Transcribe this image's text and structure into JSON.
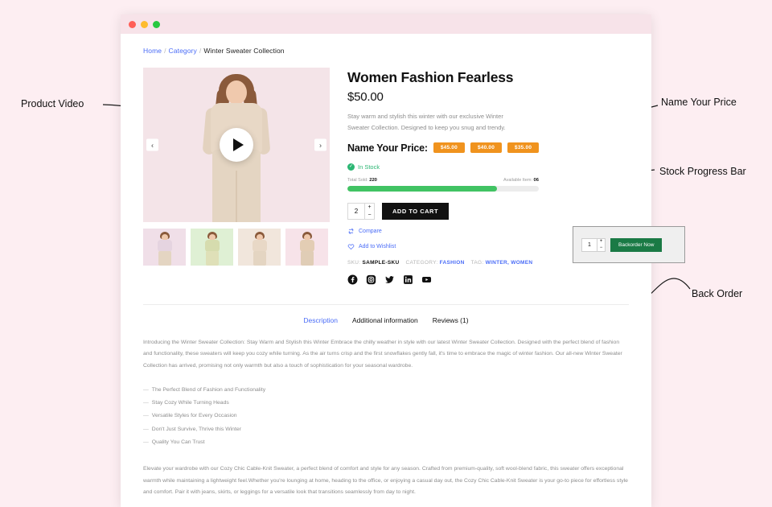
{
  "window": {
    "dots": [
      "close",
      "minimize",
      "maximize"
    ]
  },
  "breadcrumb": {
    "home": "Home",
    "category": "Category",
    "current": "Winter Sweater Collection",
    "separator": "/"
  },
  "gallery": {
    "prev_icon": "chevron-left-icon",
    "next_icon": "chevron-right-icon",
    "play_icon": "play-icon",
    "thumbnails": [
      {
        "bg": "#f0dfe8"
      },
      {
        "bg": "#dff0d4"
      },
      {
        "bg": "#f1e6dc"
      },
      {
        "bg": "#f7e3e9"
      }
    ]
  },
  "product": {
    "title": "Women Fashion Fearless",
    "price": "$50.00",
    "description": "Stay warm and stylish this winter with our exclusive Winter Sweater Collection. Designed to keep you snug and trendy.",
    "name_your_price_label": "Name Your Price:",
    "price_options": [
      "$45.00",
      "$40.00",
      "$35.00"
    ],
    "stock_status": "In Stock",
    "total_sold_label": "Total Sold:",
    "total_sold_value": "220",
    "available_label": "Available Item:",
    "available_value": "06",
    "progress_percent": 78,
    "quantity": "2",
    "add_to_cart_label": "ADD TO CART",
    "compare_label": "Compare",
    "wishlist_label": "Add to Wishlist",
    "meta": {
      "sku_label": "SKU:",
      "sku_value": "SAMPLE-SKU",
      "category_label": "CATEGORY:",
      "category_value": "FASHION",
      "tag_label": "TAG:",
      "tag_value": "WINTER, WOMEN"
    },
    "socials": [
      "facebook-icon",
      "instagram-icon",
      "twitter-icon",
      "linkedin-icon",
      "youtube-icon"
    ]
  },
  "tabs": [
    {
      "label": "Description",
      "active": true
    },
    {
      "label": "Additional information",
      "active": false
    },
    {
      "label": "Reviews (1)",
      "active": false
    }
  ],
  "content": {
    "paragraph_1": "Introducing the Winter Sweater Collection: Stay Warm and Stylish this Winter Embrace the chilly weather in style with our latest Winter Sweater Collection. Designed with the perfect blend of fashion and functionality, these sweaters will keep you cozy while turning. As the air turns crisp and the first snowflakes gently fall, it's time to embrace the magic of winter fashion. Our all-new Winter Sweater Collection has arrived, promising not only warmth but also a touch of sophistication for your seasonal wardrobe.",
    "bullets": [
      "The Perfect Blend of Fashion and Functionality",
      "Stay Cozy While Turning Heads",
      "Versatile Styles for Every Occasion",
      "Don't Just Survive, Thrive this Winter",
      "Quality You Can Trust"
    ],
    "paragraph_2": "Elevate your wardrobe with our Cozy Chic Cable-Knit Sweater, a perfect blend of comfort and style for any season. Crafted from premium-quality, soft wool-blend fabric, this sweater offers exceptional warmth while maintaining a lightweight feel.Whether you're lounging at home, heading to the office, or enjoying a casual day out, the Cozy Chic Cable-Knit Sweater is your go-to piece for effortless style and comfort. Pair it with jeans, skirts, or leggings for a versatile look that transitions seamlessly from day to night."
  },
  "backorder": {
    "quantity": "1",
    "button_label": "Backorder Now"
  },
  "annotations": [
    {
      "text": "Product Video"
    },
    {
      "text": "Name Your Price"
    },
    {
      "text": "Stock Progress Bar"
    },
    {
      "text": "Back Order"
    }
  ],
  "colors": {
    "page_bg": "#fdeef2",
    "accent_blue": "#4a6cf7",
    "badge_orange": "#f0931e",
    "stock_green": "#2bb673",
    "progress_green": "#41c363",
    "backorder_green": "#1a7a45",
    "dark": "#111111"
  }
}
